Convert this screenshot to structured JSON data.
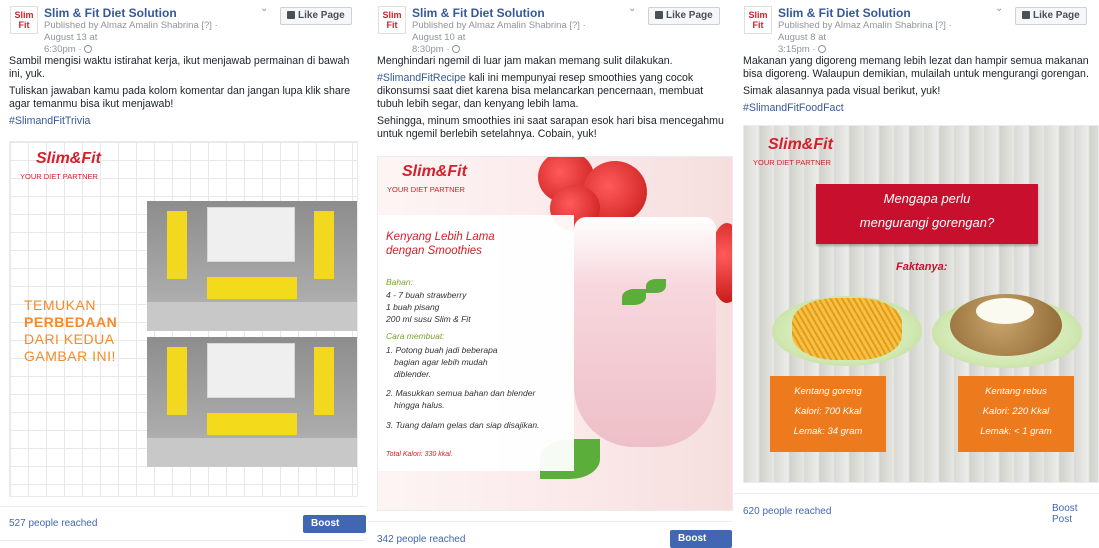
{
  "posts": [
    {
      "page_name": "Slim & Fit Diet Solution",
      "published_by": "Published by Almaz Amalin Shabrina",
      "help_mark": "[?]",
      "date": "· August 13 at",
      "time": "6:30pm ·",
      "like_label": "Like Page",
      "paragraphs": [
        "Sambil mengisi waktu istirahat kerja, ikut menjawab permainan di bawah ini, yuk.",
        "Tuliskan jawaban kamu pada kolom komentar dan jangan lupa klik share agar temanmu bisa ikut menjawab!"
      ],
      "hashtag": "#SlimandFitTrivia",
      "image": {
        "brand": "Slim&Fit",
        "brand_sub": "YOUR DIET PARTNER",
        "lines": [
          "TEMUKAN",
          "PERBEDAAN",
          "DARI KEDUA",
          "GAMBAR INI!"
        ]
      },
      "reach": "527 people reached",
      "boost_label": "Boost Post"
    },
    {
      "page_name": "Slim & Fit Diet Solution",
      "published_by": "Published by Almaz Amalin Shabrina",
      "help_mark": "[?]",
      "date": "· August 10 at",
      "time": "8:30pm ·",
      "like_label": "Like Page",
      "para1": "Menghindari ngemil di luar jam makan memang sulit dilakukan.",
      "hashtag": "#SlimandFitRecipe",
      "para2_rest": " kali ini mempunyai resep smoothies yang cocok dikonsumsi saat diet karena bisa melancarkan pencernaan, membuat tubuh lebih segar, dan kenyang lebih lama.",
      "para3": "Sehingga, minum smoothies ini saat sarapan esok hari bisa mencegahmu untuk ngemil berlebih setelahnya. Cobain, yuk!",
      "image": {
        "brand": "Slim&Fit",
        "brand_sub": "YOUR DIET PARTNER",
        "title_1": "Kenyang Lebih Lama",
        "title_2": "dengan Smoothies",
        "bahan_label": "Bahan:",
        "bahan": [
          "4 - 7 buah strawberry",
          "1 buah pisang",
          "200 ml susu Slim & Fit"
        ],
        "cara_label": "Cara membuat:",
        "cara": [
          "1. Potong buah jadi beberapa",
          "bagian agar lebih mudah",
          "diblender.",
          "2. Masukkan semua bahan dan blender",
          "hingga halus.",
          "3. Tuang dalam gelas dan siap disajikan."
        ],
        "kalori": "Total Kalori: 330 kkal."
      },
      "reach": "342 people reached",
      "boost_label": "Boost Post"
    },
    {
      "page_name": "Slim & Fit Diet Solution",
      "published_by": "Published by Almaz Amalin Shabrina",
      "help_mark": "[?]",
      "date": "· August 8 at",
      "time": "3:15pm ·",
      "like_label": "Like Page",
      "paragraphs": [
        "Makanan yang digoreng memang lebih lezat dan hampir semua makanan bisa digoreng. Walaupun demikian, mulailah untuk mengurangi gorengan.",
        "Simak alasannya pada visual berikut, yuk!"
      ],
      "hashtag": "#SlimandFitFoodFact",
      "image": {
        "brand": "Slim&Fit",
        "brand_sub": "YOUR DIET PARTNER",
        "banner_1": "Mengapa perlu",
        "banner_2": "mengurangi gorengan?",
        "fakta": "Faktanya:",
        "left": [
          "Kentang goreng",
          "Kalori: 700 Kkal",
          "Lemak: 34 gram"
        ],
        "right": [
          "Kentang rebus",
          "Kalori: 220 Kkal",
          "Lemak: < 1 gram"
        ]
      },
      "reach": "620 people reached",
      "boost_label": "Boost Post"
    }
  ],
  "logo_text": [
    "Slim",
    "Fit"
  ]
}
